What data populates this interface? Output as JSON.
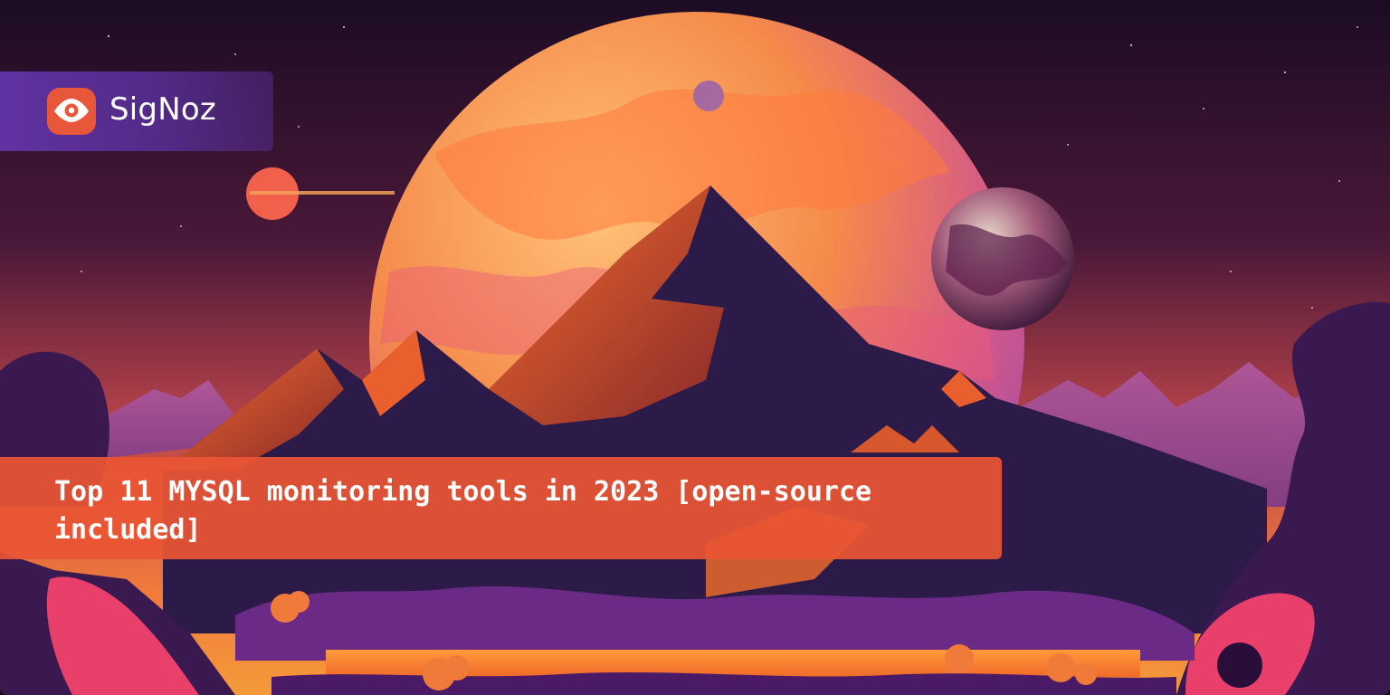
{
  "brand": {
    "name": "SigNoz",
    "logo_icon": "eye-icon",
    "logo_color": "#e8573a"
  },
  "article": {
    "title": "Top 11 MYSQL monitoring tools in 2023 [open-source included]"
  },
  "colors": {
    "brand_bar": "#6234a8",
    "title_bar": "#e95534",
    "sky_top": "#1c0c24",
    "sky_horizon": "#f07a3c"
  }
}
